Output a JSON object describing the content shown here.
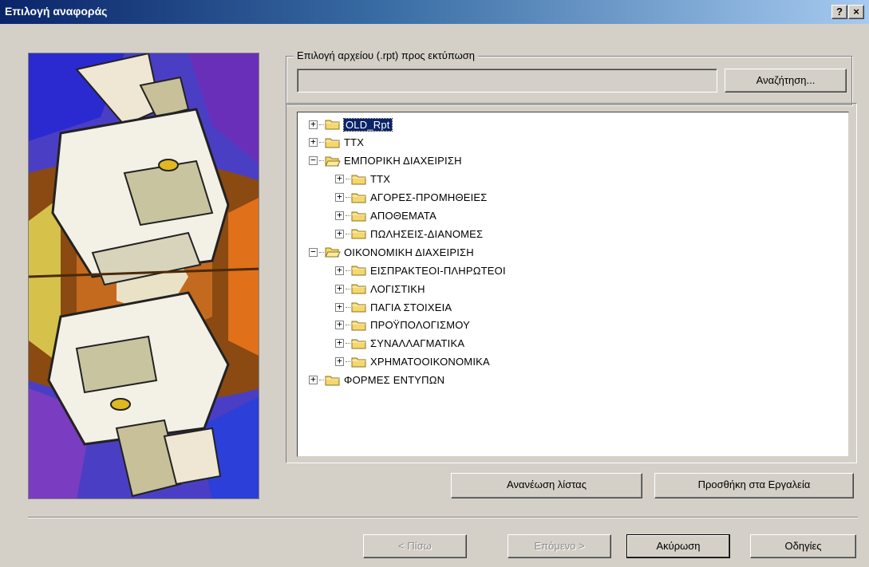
{
  "window": {
    "title": "Επιλογή αναφοράς",
    "help_button": "?",
    "close_button": "×"
  },
  "file_group": {
    "legend": "Επιλογή αρχείου (.rpt) προς εκτύπωση",
    "path_value": "",
    "browse_label": "Αναζήτηση..."
  },
  "tree": {
    "nodes": [
      {
        "label": "OLD_Rpt",
        "level": 0,
        "expander": "+",
        "expanded": false,
        "selected": true
      },
      {
        "label": "TTX",
        "level": 0,
        "expander": "+",
        "expanded": false
      },
      {
        "label": "ΕΜΠΟΡΙΚΗ ΔΙΑΧΕΙΡΙΣΗ",
        "level": 0,
        "expander": "−",
        "expanded": true
      },
      {
        "label": "TTX",
        "level": 1,
        "expander": "+",
        "expanded": false
      },
      {
        "label": "ΑΓΟΡΕΣ-ΠΡΟΜΗΘΕΙΕΣ",
        "level": 1,
        "expander": "+",
        "expanded": false
      },
      {
        "label": "ΑΠΟΘΕΜΑΤΑ",
        "level": 1,
        "expander": "+",
        "expanded": false
      },
      {
        "label": "ΠΩΛΗΣΕΙΣ-ΔΙΑΝΟΜΕΣ",
        "level": 1,
        "expander": "+",
        "expanded": false
      },
      {
        "label": "ΟΙΚΟΝΟΜΙΚΗ ΔΙΑΧΕΙΡΙΣΗ",
        "level": 0,
        "expander": "−",
        "expanded": true
      },
      {
        "label": "ΕΙΣΠΡΑΚΤΕΟΙ-ΠΛΗΡΩΤΕΟΙ",
        "level": 1,
        "expander": "+",
        "expanded": false
      },
      {
        "label": "ΛΟΓΙΣΤΙΚΗ",
        "level": 1,
        "expander": "+",
        "expanded": false
      },
      {
        "label": "ΠΑΓΙΑ ΣΤΟΙΧΕΙΑ",
        "level": 1,
        "expander": "+",
        "expanded": false
      },
      {
        "label": "ΠΡΟΫΠΟΛΟΓΙΣΜΟΥ",
        "level": 1,
        "expander": "+",
        "expanded": false
      },
      {
        "label": "ΣΥΝΑΛΛΑΓΜΑΤΙΚΑ",
        "level": 1,
        "expander": "+",
        "expanded": false
      },
      {
        "label": "ΧΡΗΜΑΤΟΟΙΚΟΝΟΜΙΚΑ",
        "level": 1,
        "expander": "+",
        "expanded": false
      },
      {
        "label": "ΦΟΡΜΕΣ ΕΝΤΥΠΩΝ",
        "level": 0,
        "expander": "+",
        "expanded": false
      }
    ]
  },
  "actions": {
    "refresh_label": "Ανανέωση λίστας",
    "add_tools_label": "Προσθήκη στα Εργαλεία"
  },
  "footer": {
    "back_label": "< Πίσω",
    "next_label": "Επόμενο >",
    "cancel_label": "Ακύρωση",
    "help_label": "Οδηγίες"
  },
  "colors": {
    "title_gradient_start": "#0a246a",
    "title_gradient_end": "#a6caf0",
    "selection": "#0a246a",
    "folder": "#f5d76e"
  }
}
